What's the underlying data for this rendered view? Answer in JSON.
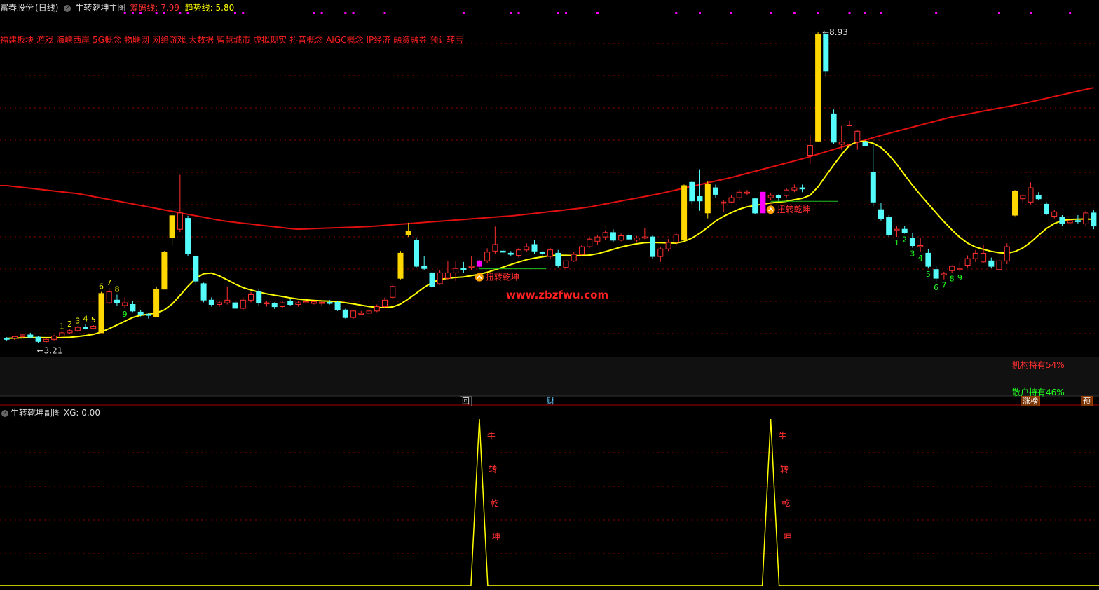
{
  "header": {
    "stock_name": "富春股份",
    "period": "(日线)",
    "indicator_name": "牛转乾坤主图",
    "chip_label": "筹码线",
    "chip_value": "7.99",
    "trend_label": "趋势线",
    "trend_value": "5.80"
  },
  "concepts": [
    "福建板块",
    "游戏",
    "海峡西岸",
    "5G概念",
    "物联网",
    "网络游戏",
    "大数据",
    "智慧城市",
    "虚拟现实",
    "抖音概念",
    "AIGC概念",
    "IP经济",
    "融资融券",
    "预计转亏"
  ],
  "holdings": {
    "institution": "机构持有54%",
    "retail": "散户持有46%"
  },
  "buttons": {
    "review": "回",
    "finance": "财",
    "rank": "涨榜",
    "forecast": "预"
  },
  "sub_header": {
    "title": "牛转乾坤副图",
    "xg_label": "XG",
    "xg_value": "0.00"
  },
  "signal_text": "扭转乾坤",
  "watermark": "www.zbzfwu.com",
  "peak_chars": [
    "牛",
    "转",
    "乾",
    "坤"
  ],
  "colors": {
    "up": "#ff3030",
    "down": "#54fcfc",
    "limit": "#ffd700",
    "signal": "#ff00ff",
    "chip_line": "#e01010",
    "trend_line": "#ffff00",
    "grid": "#8b0000",
    "count_up": "#ffff00",
    "count_down": "#20ff20"
  },
  "chart_data": {
    "type": "candlestick",
    "ylim": [
      3.0,
      9.2
    ],
    "price_annotations": {
      "high": "8.93",
      "low": "3.21"
    },
    "candles": [
      {
        "o": 3.28,
        "h": 3.32,
        "l": 3.25,
        "c": 3.3,
        "k": "down"
      },
      {
        "o": 3.3,
        "h": 3.35,
        "l": 3.27,
        "c": 3.33,
        "k": "up"
      },
      {
        "o": 3.33,
        "h": 3.38,
        "l": 3.3,
        "c": 3.36,
        "k": "up"
      },
      {
        "o": 3.36,
        "h": 3.4,
        "l": 3.3,
        "c": 3.32,
        "k": "down"
      },
      {
        "o": 3.32,
        "h": 3.34,
        "l": 3.21,
        "c": 3.24,
        "k": "down"
      },
      {
        "o": 3.24,
        "h": 3.3,
        "l": 3.21,
        "c": 3.28,
        "k": "up"
      },
      {
        "o": 3.28,
        "h": 3.36,
        "l": 3.26,
        "c": 3.34,
        "k": "up"
      },
      {
        "o": 3.34,
        "h": 3.42,
        "l": 3.32,
        "c": 3.4,
        "k": "up"
      },
      {
        "o": 3.4,
        "h": 3.46,
        "l": 3.38,
        "c": 3.44,
        "k": "up"
      },
      {
        "o": 3.44,
        "h": 3.52,
        "l": 3.42,
        "c": 3.5,
        "k": "up"
      },
      {
        "o": 3.5,
        "h": 3.56,
        "l": 3.46,
        "c": 3.48,
        "k": "down"
      },
      {
        "o": 3.48,
        "h": 3.54,
        "l": 3.46,
        "c": 3.52,
        "k": "up"
      },
      {
        "o": 3.4,
        "h": 4.15,
        "l": 3.4,
        "c": 4.12,
        "k": "limit"
      },
      {
        "o": 3.95,
        "h": 4.22,
        "l": 3.92,
        "c": 4.15,
        "k": "up"
      },
      {
        "o": 4.0,
        "h": 4.1,
        "l": 3.9,
        "c": 3.95,
        "k": "down"
      },
      {
        "o": 3.95,
        "h": 4.05,
        "l": 3.85,
        "c": 3.9,
        "k": "up"
      },
      {
        "o": 3.92,
        "h": 3.98,
        "l": 3.78,
        "c": 3.8,
        "k": "down"
      },
      {
        "o": 3.78,
        "h": 3.82,
        "l": 3.7,
        "c": 3.74,
        "k": "down"
      },
      {
        "o": 3.74,
        "h": 3.76,
        "l": 3.66,
        "c": 3.72,
        "k": "down"
      },
      {
        "o": 3.7,
        "h": 4.25,
        "l": 3.7,
        "c": 4.2,
        "k": "limit"
      },
      {
        "o": 4.2,
        "h": 4.9,
        "l": 4.2,
        "c": 4.88,
        "k": "limit"
      },
      {
        "o": 5.15,
        "h": 5.6,
        "l": 5.0,
        "c": 5.55,
        "k": "limit"
      },
      {
        "o": 5.3,
        "h": 6.3,
        "l": 5.25,
        "c": 5.6,
        "k": "up"
      },
      {
        "o": 5.5,
        "h": 5.55,
        "l": 4.8,
        "c": 4.85,
        "k": "down"
      },
      {
        "o": 4.8,
        "h": 4.82,
        "l": 4.3,
        "c": 4.35,
        "k": "down"
      },
      {
        "o": 4.3,
        "h": 4.32,
        "l": 3.96,
        "c": 4.0,
        "k": "down"
      },
      {
        "o": 4.0,
        "h": 4.05,
        "l": 3.88,
        "c": 3.92,
        "k": "down"
      },
      {
        "o": 3.92,
        "h": 3.98,
        "l": 3.88,
        "c": 3.95,
        "k": "up"
      },
      {
        "o": 3.95,
        "h": 4.25,
        "l": 3.92,
        "c": 4.0,
        "k": "up"
      },
      {
        "o": 3.95,
        "h": 4.05,
        "l": 3.82,
        "c": 3.85,
        "k": "down"
      },
      {
        "o": 3.85,
        "h": 4.05,
        "l": 3.8,
        "c": 4.0,
        "k": "up"
      },
      {
        "o": 4.0,
        "h": 4.15,
        "l": 3.96,
        "c": 4.1,
        "k": "up"
      },
      {
        "o": 4.15,
        "h": 4.2,
        "l": 3.9,
        "c": 3.95,
        "k": "down"
      },
      {
        "o": 3.95,
        "h": 3.98,
        "l": 3.88,
        "c": 3.94,
        "k": "up"
      },
      {
        "o": 3.94,
        "h": 3.96,
        "l": 3.84,
        "c": 3.88,
        "k": "down"
      },
      {
        "o": 3.88,
        "h": 3.98,
        "l": 3.85,
        "c": 3.95,
        "k": "up"
      },
      {
        "o": 3.98,
        "h": 4.02,
        "l": 3.9,
        "c": 3.92,
        "k": "down"
      },
      {
        "o": 3.92,
        "h": 3.98,
        "l": 3.88,
        "c": 3.95,
        "k": "up"
      },
      {
        "o": 3.95,
        "h": 3.99,
        "l": 3.92,
        "c": 3.97,
        "k": "up"
      },
      {
        "o": 3.97,
        "h": 3.99,
        "l": 3.92,
        "c": 3.94,
        "k": "up"
      },
      {
        "o": 3.94,
        "h": 3.99,
        "l": 3.9,
        "c": 3.96,
        "k": "up"
      },
      {
        "o": 3.96,
        "h": 4.0,
        "l": 3.92,
        "c": 3.94,
        "k": "down"
      },
      {
        "o": 3.96,
        "h": 3.98,
        "l": 3.8,
        "c": 3.82,
        "k": "down"
      },
      {
        "o": 3.82,
        "h": 3.84,
        "l": 3.66,
        "c": 3.68,
        "k": "down"
      },
      {
        "o": 3.68,
        "h": 3.82,
        "l": 3.66,
        "c": 3.8,
        "k": "up"
      },
      {
        "o": 3.76,
        "h": 3.8,
        "l": 3.72,
        "c": 3.76,
        "k": "up"
      },
      {
        "o": 3.76,
        "h": 3.82,
        "l": 3.72,
        "c": 3.8,
        "k": "up"
      },
      {
        "o": 3.8,
        "h": 3.92,
        "l": 3.78,
        "c": 3.88,
        "k": "up"
      },
      {
        "o": 3.88,
        "h": 4.05,
        "l": 3.85,
        "c": 4.0,
        "k": "up"
      },
      {
        "o": 4.05,
        "h": 4.28,
        "l": 4.02,
        "c": 4.25,
        "k": "up"
      },
      {
        "o": 4.4,
        "h": 4.9,
        "l": 4.38,
        "c": 4.86,
        "k": "limit"
      },
      {
        "o": 5.2,
        "h": 5.42,
        "l": 5.16,
        "c": 5.26,
        "k": "limit"
      },
      {
        "o": 5.1,
        "h": 5.15,
        "l": 4.6,
        "c": 4.62,
        "k": "down"
      },
      {
        "o": 4.62,
        "h": 4.8,
        "l": 4.55,
        "c": 4.58,
        "k": "down"
      },
      {
        "o": 4.5,
        "h": 4.52,
        "l": 4.22,
        "c": 4.25,
        "k": "down"
      },
      {
        "o": 4.3,
        "h": 4.55,
        "l": 4.28,
        "c": 4.5,
        "k": "up"
      },
      {
        "o": 4.4,
        "h": 4.72,
        "l": 4.38,
        "c": 4.5,
        "k": "up"
      },
      {
        "o": 4.5,
        "h": 4.72,
        "l": 4.35,
        "c": 4.58,
        "k": "up"
      },
      {
        "o": 4.58,
        "h": 4.7,
        "l": 4.5,
        "c": 4.55,
        "k": "down"
      },
      {
        "o": 4.62,
        "h": 4.8,
        "l": 4.55,
        "c": 4.62,
        "k": "up"
      },
      {
        "o": 4.62,
        "h": 4.74,
        "l": 4.6,
        "c": 4.72,
        "k": "signal"
      },
      {
        "o": 4.72,
        "h": 4.95,
        "l": 4.68,
        "c": 4.88,
        "k": "up"
      },
      {
        "o": 4.9,
        "h": 5.35,
        "l": 4.85,
        "c": 5.02,
        "k": "up"
      },
      {
        "o": 4.9,
        "h": 4.95,
        "l": 4.84,
        "c": 4.88,
        "k": "down"
      },
      {
        "o": 4.86,
        "h": 4.9,
        "l": 4.8,
        "c": 4.84,
        "k": "down"
      },
      {
        "o": 4.82,
        "h": 4.96,
        "l": 4.78,
        "c": 4.92,
        "k": "up"
      },
      {
        "o": 4.92,
        "h": 5.04,
        "l": 4.88,
        "c": 4.98,
        "k": "up"
      },
      {
        "o": 5.02,
        "h": 5.1,
        "l": 4.85,
        "c": 4.9,
        "k": "down"
      },
      {
        "o": 4.88,
        "h": 4.9,
        "l": 4.8,
        "c": 4.86,
        "k": "down"
      },
      {
        "o": 4.8,
        "h": 4.96,
        "l": 4.76,
        "c": 4.92,
        "k": "up"
      },
      {
        "o": 4.86,
        "h": 4.92,
        "l": 4.6,
        "c": 4.64,
        "k": "down"
      },
      {
        "o": 4.6,
        "h": 4.76,
        "l": 4.58,
        "c": 4.72,
        "k": "up"
      },
      {
        "o": 4.72,
        "h": 4.88,
        "l": 4.7,
        "c": 4.84,
        "k": "up"
      },
      {
        "o": 4.84,
        "h": 5.02,
        "l": 4.82,
        "c": 4.98,
        "k": "up"
      },
      {
        "o": 4.98,
        "h": 5.15,
        "l": 4.96,
        "c": 5.12,
        "k": "up"
      },
      {
        "o": 5.08,
        "h": 5.2,
        "l": 5.02,
        "c": 5.16,
        "k": "up"
      },
      {
        "o": 5.16,
        "h": 5.28,
        "l": 5.1,
        "c": 5.24,
        "k": "up"
      },
      {
        "o": 5.24,
        "h": 5.3,
        "l": 5.06,
        "c": 5.1,
        "k": "down"
      },
      {
        "o": 5.1,
        "h": 5.22,
        "l": 5.08,
        "c": 5.18,
        "k": "up"
      },
      {
        "o": 5.18,
        "h": 5.24,
        "l": 5.1,
        "c": 5.12,
        "k": "down"
      },
      {
        "o": 5.1,
        "h": 5.18,
        "l": 5.06,
        "c": 5.14,
        "k": "up"
      },
      {
        "o": 5.14,
        "h": 5.32,
        "l": 5.12,
        "c": 5.16,
        "k": "up"
      },
      {
        "o": 5.16,
        "h": 5.2,
        "l": 4.76,
        "c": 4.8,
        "k": "down"
      },
      {
        "o": 4.8,
        "h": 4.98,
        "l": 4.7,
        "c": 4.94,
        "k": "up"
      },
      {
        "o": 4.94,
        "h": 5.12,
        "l": 4.9,
        "c": 5.06,
        "k": "up"
      },
      {
        "o": 5.06,
        "h": 5.24,
        "l": 5.0,
        "c": 5.2,
        "k": "up"
      },
      {
        "o": 5.1,
        "h": 6.12,
        "l": 5.1,
        "c": 6.1,
        "k": "limit"
      },
      {
        "o": 6.16,
        "h": 6.18,
        "l": 5.76,
        "c": 5.82,
        "k": "down"
      },
      {
        "o": 5.82,
        "h": 6.4,
        "l": 5.64,
        "c": 5.9,
        "k": "down"
      },
      {
        "o": 5.6,
        "h": 6.18,
        "l": 5.5,
        "c": 6.12,
        "k": "limit"
      },
      {
        "o": 6.06,
        "h": 6.12,
        "l": 5.88,
        "c": 5.94,
        "k": "down"
      },
      {
        "o": 5.78,
        "h": 5.84,
        "l": 5.62,
        "c": 5.8,
        "k": "up"
      },
      {
        "o": 5.8,
        "h": 5.92,
        "l": 5.78,
        "c": 5.88,
        "k": "up"
      },
      {
        "o": 5.88,
        "h": 6.04,
        "l": 5.84,
        "c": 5.98,
        "k": "up"
      },
      {
        "o": 5.98,
        "h": 6.02,
        "l": 5.92,
        "c": 5.96,
        "k": "up"
      },
      {
        "o": 5.86,
        "h": 5.88,
        "l": 5.58,
        "c": 5.6,
        "k": "down"
      },
      {
        "o": 5.6,
        "h": 6.0,
        "l": 5.58,
        "c": 5.98,
        "k": "signal"
      },
      {
        "o": 5.92,
        "h": 5.96,
        "l": 5.84,
        "c": 5.88,
        "k": "up"
      },
      {
        "o": 5.88,
        "h": 5.94,
        "l": 5.82,
        "c": 5.92,
        "k": "down"
      },
      {
        "o": 5.92,
        "h": 6.06,
        "l": 5.88,
        "c": 6.02,
        "k": "up"
      },
      {
        "o": 6.02,
        "h": 6.12,
        "l": 5.98,
        "c": 6.06,
        "k": "up"
      },
      {
        "o": 6.06,
        "h": 6.12,
        "l": 5.98,
        "c": 6.04,
        "k": "down"
      },
      {
        "o": 6.66,
        "h": 7.04,
        "l": 6.5,
        "c": 6.84,
        "k": "up"
      },
      {
        "o": 6.92,
        "h": 8.93,
        "l": 6.9,
        "c": 8.88,
        "k": "limit"
      },
      {
        "o": 8.88,
        "h": 8.93,
        "l": 8.1,
        "c": 8.2,
        "k": "down"
      },
      {
        "o": 7.42,
        "h": 7.5,
        "l": 6.86,
        "c": 6.9,
        "k": "down"
      },
      {
        "o": 6.9,
        "h": 7.2,
        "l": 6.76,
        "c": 6.86,
        "k": "up"
      },
      {
        "o": 6.86,
        "h": 7.3,
        "l": 6.8,
        "c": 7.2,
        "k": "up"
      },
      {
        "o": 7.1,
        "h": 7.12,
        "l": 6.76,
        "c": 6.9,
        "k": "up"
      },
      {
        "o": 6.9,
        "h": 6.92,
        "l": 6.82,
        "c": 6.84,
        "k": "down"
      },
      {
        "o": 6.34,
        "h": 6.86,
        "l": 5.72,
        "c": 5.8,
        "k": "down"
      },
      {
        "o": 5.66,
        "h": 5.78,
        "l": 5.46,
        "c": 5.5,
        "k": "down"
      },
      {
        "o": 5.52,
        "h": 5.56,
        "l": 5.16,
        "c": 5.2,
        "k": "down"
      },
      {
        "o": 5.28,
        "h": 5.36,
        "l": 5.16,
        "c": 5.3,
        "k": "up"
      },
      {
        "o": 5.3,
        "h": 5.36,
        "l": 5.22,
        "c": 5.24,
        "k": "down"
      },
      {
        "o": 5.14,
        "h": 5.24,
        "l": 4.96,
        "c": 5.0,
        "k": "down"
      },
      {
        "o": 5.0,
        "h": 5.14,
        "l": 4.88,
        "c": 5.0,
        "k": "up"
      },
      {
        "o": 4.86,
        "h": 4.94,
        "l": 4.58,
        "c": 4.62,
        "k": "down"
      },
      {
        "o": 4.56,
        "h": 4.62,
        "l": 4.34,
        "c": 4.4,
        "k": "down"
      },
      {
        "o": 4.46,
        "h": 4.52,
        "l": 4.38,
        "c": 4.48,
        "k": "up"
      },
      {
        "o": 4.54,
        "h": 4.64,
        "l": 4.5,
        "c": 4.62,
        "k": "up"
      },
      {
        "o": 4.58,
        "h": 4.7,
        "l": 4.52,
        "c": 4.56,
        "k": "up"
      },
      {
        "o": 4.64,
        "h": 4.82,
        "l": 4.6,
        "c": 4.76,
        "k": "up"
      },
      {
        "o": 4.76,
        "h": 4.92,
        "l": 4.7,
        "c": 4.86,
        "k": "up"
      },
      {
        "o": 4.7,
        "h": 5.02,
        "l": 4.68,
        "c": 4.86,
        "k": "up"
      },
      {
        "o": 4.72,
        "h": 4.78,
        "l": 4.58,
        "c": 4.62,
        "k": "down"
      },
      {
        "o": 4.56,
        "h": 4.78,
        "l": 4.5,
        "c": 4.72,
        "k": "up"
      },
      {
        "o": 4.72,
        "h": 5.04,
        "l": 4.66,
        "c": 4.98,
        "k": "up"
      },
      {
        "o": 5.56,
        "h": 6.02,
        "l": 5.54,
        "c": 6.0,
        "k": "limit"
      },
      {
        "o": 5.86,
        "h": 5.94,
        "l": 5.78,
        "c": 5.92,
        "k": "up"
      },
      {
        "o": 5.8,
        "h": 6.16,
        "l": 5.76,
        "c": 6.06,
        "k": "up"
      },
      {
        "o": 5.92,
        "h": 5.98,
        "l": 5.84,
        "c": 5.86,
        "k": "down"
      },
      {
        "o": 5.76,
        "h": 5.8,
        "l": 5.56,
        "c": 5.58,
        "k": "down"
      },
      {
        "o": 5.54,
        "h": 5.66,
        "l": 5.5,
        "c": 5.62,
        "k": "up"
      },
      {
        "o": 5.52,
        "h": 5.56,
        "l": 5.36,
        "c": 5.4,
        "k": "down"
      },
      {
        "o": 5.42,
        "h": 5.5,
        "l": 5.38,
        "c": 5.46,
        "k": "up"
      },
      {
        "o": 5.46,
        "h": 5.56,
        "l": 5.4,
        "c": 5.44,
        "k": "down"
      },
      {
        "o": 5.4,
        "h": 5.64,
        "l": 5.36,
        "c": 5.6,
        "k": "up"
      },
      {
        "o": 5.6,
        "h": 5.66,
        "l": 5.3,
        "c": 5.36,
        "k": "down"
      }
    ],
    "count_labels": [
      {
        "i": 7,
        "t": "1",
        "k": "up"
      },
      {
        "i": 8,
        "t": "2",
        "k": "up"
      },
      {
        "i": 9,
        "t": "3",
        "k": "up"
      },
      {
        "i": 10,
        "t": "4",
        "k": "up"
      },
      {
        "i": 11,
        "t": "5",
        "k": "up"
      },
      {
        "i": 12,
        "t": "6",
        "k": "up"
      },
      {
        "i": 13,
        "t": "7",
        "k": "up"
      },
      {
        "i": 14,
        "t": "8",
        "k": "up"
      },
      {
        "i": 15,
        "t": "9",
        "k": "down"
      },
      {
        "i": 113,
        "t": "1",
        "k": "down"
      },
      {
        "i": 114,
        "t": "2",
        "k": "down"
      },
      {
        "i": 115,
        "t": "3",
        "k": "down"
      },
      {
        "i": 116,
        "t": "4",
        "k": "down"
      },
      {
        "i": 117,
        "t": "5",
        "k": "down"
      },
      {
        "i": 118,
        "t": "6",
        "k": "down"
      },
      {
        "i": 119,
        "t": "7",
        "k": "down"
      },
      {
        "i": 120,
        "t": "8",
        "k": "down"
      },
      {
        "i": 121,
        "t": "9",
        "k": "down"
      }
    ],
    "signals": [
      60,
      97
    ],
    "sub_peaks": [
      60,
      97
    ]
  }
}
